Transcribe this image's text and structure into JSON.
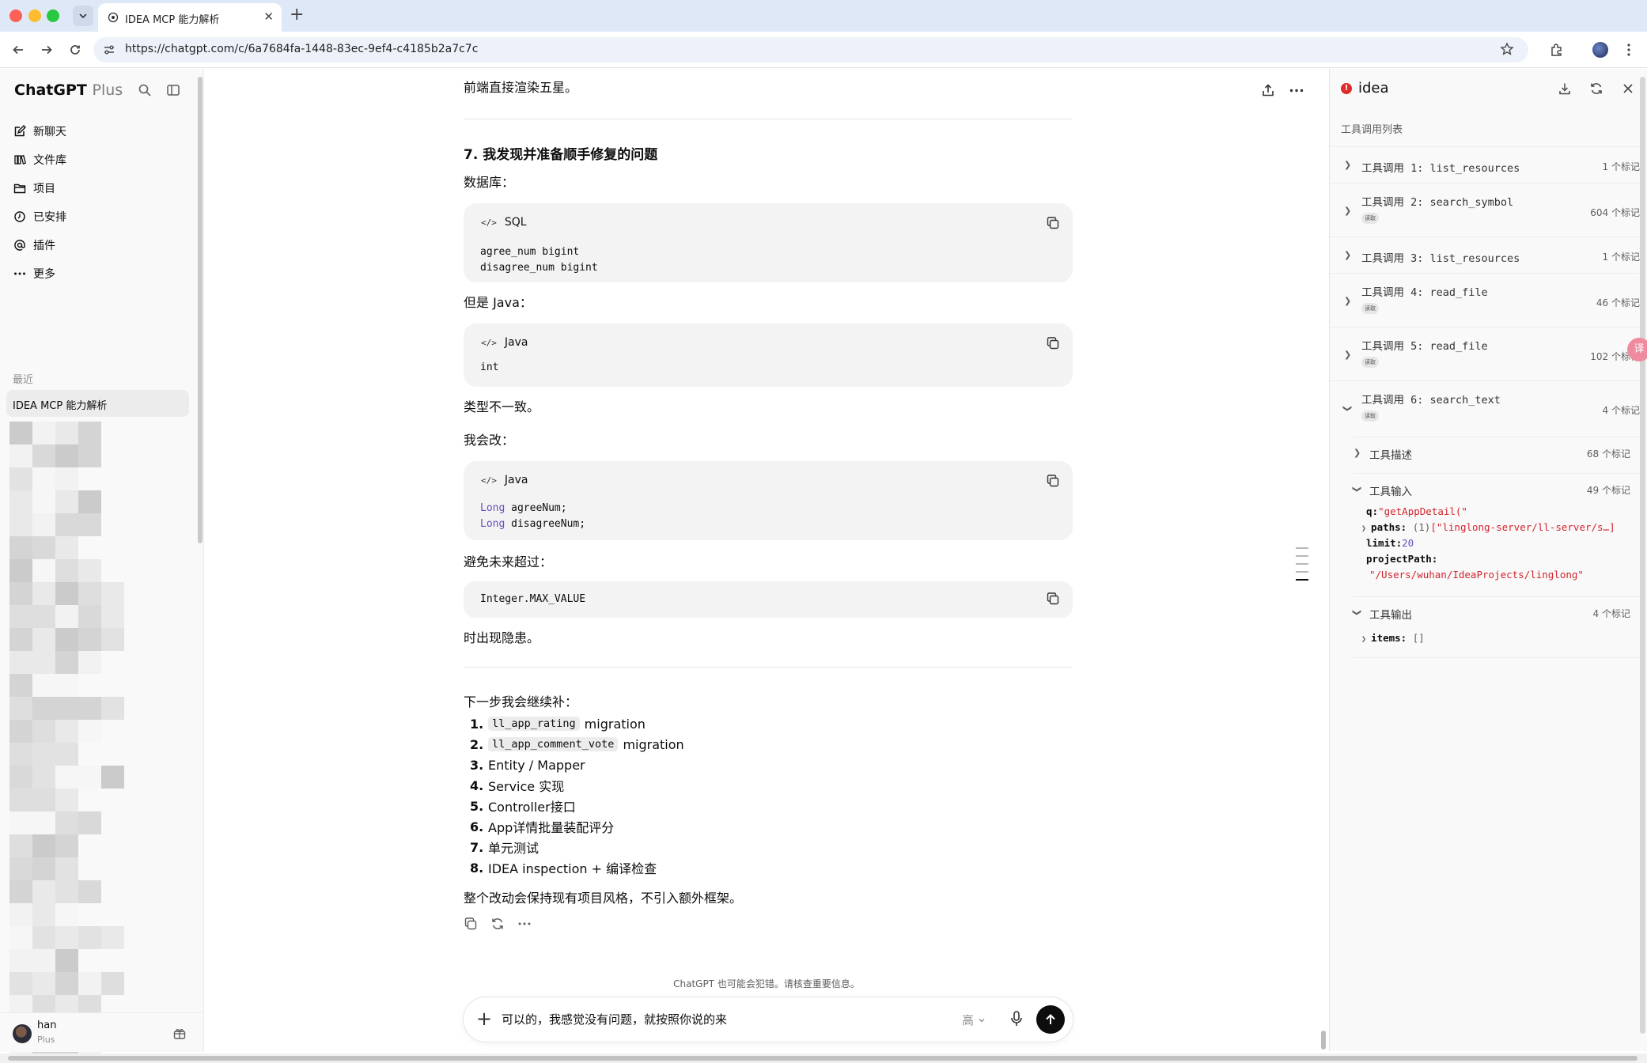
{
  "browser": {
    "tab_title": "IDEA MCP 能力解析",
    "url": "https://chatgpt.com/c/6a7684fa-1448-83ec-9ef4-c4185b2a7c7c"
  },
  "sidebar": {
    "brand": "ChatGPT",
    "brand_plan": "Plus",
    "nav": [
      {
        "label": "新聊天",
        "icon": "edit-icon"
      },
      {
        "label": "文件库",
        "icon": "library-icon"
      },
      {
        "label": "项目",
        "icon": "folder-icon"
      },
      {
        "label": "已安排",
        "icon": "clock-icon"
      },
      {
        "label": "插件",
        "icon": "at-icon"
      },
      {
        "label": "更多",
        "icon": "more-icon"
      }
    ],
    "recent_label": "最近",
    "active_chat": "IDEA MCP 能力解析",
    "user": {
      "name": "han",
      "plan": "Plus"
    }
  },
  "chat": {
    "intro_line": "前端直接渲染五星。",
    "section_title": "7. 我发现并准备顺手修复的问题",
    "db_label": "数据库：",
    "sql_block": {
      "lang": "SQL",
      "lines": [
        "agree_num bigint",
        "disagree_num bigint"
      ]
    },
    "java_label": "但是 Java：",
    "java_block": {
      "lang": "Java",
      "lines": [
        "int"
      ]
    },
    "type_mismatch": "类型不一致。",
    "will_change": "我会改：",
    "java_block2": {
      "lang": "Java",
      "line1_type": "Long",
      "line1_rest": " agreeNum;",
      "line2_type": "Long",
      "line2_rest": " disagreeNum;"
    },
    "avoid_label": "避免未来超过：",
    "const_block": {
      "line": "Integer.MAX_VALUE"
    },
    "risk_line": "时出现隐患。",
    "next_steps_label": "下一步我会继续补：",
    "steps": [
      {
        "num": "1.",
        "code": "ll_app_rating",
        "text": "migration"
      },
      {
        "num": "2.",
        "code": "ll_app_comment_vote",
        "text": "migration"
      },
      {
        "num": "3.",
        "code": "",
        "text": "Entity / Mapper"
      },
      {
        "num": "4.",
        "code": "",
        "text": "Service 实现"
      },
      {
        "num": "5.",
        "code": "",
        "text": "Controller接口"
      },
      {
        "num": "6.",
        "code": "",
        "text": "App详情批量装配评分"
      },
      {
        "num": "7.",
        "code": "",
        "text": "单元测试"
      },
      {
        "num": "8.",
        "code": "",
        "text": "IDEA inspection + 编译检查"
      }
    ],
    "closing": "整个改动会保持现有项目风格，不引入额外框架。",
    "disclaimer": "ChatGPT 也可能会犯错。请核查重要信息。",
    "composer": {
      "value": "可以的，我感觉没有问题，就按照你说的来",
      "effort": "高"
    }
  },
  "panel": {
    "title": "idea",
    "subtitle": "工具调用列表",
    "badge_text": "读取",
    "calls": [
      {
        "label": "工具调用 1: list_resources",
        "count": "1 个标记",
        "badge": false
      },
      {
        "label": "工具调用 2: search_symbol",
        "count": "604 个标记",
        "badge": true
      },
      {
        "label": "工具调用 3: list_resources",
        "count": "1 个标记",
        "badge": false
      },
      {
        "label": "工具调用 4: read_file",
        "count": "46 个标记",
        "badge": true
      },
      {
        "label": "工具调用 5: read_file",
        "count": "102 个标记",
        "badge": true
      },
      {
        "label": "工具调用 6: search_text",
        "count": "4 个标记",
        "badge": true
      }
    ],
    "details": {
      "desc_label": "工具描述",
      "desc_count": "68 个标记",
      "input_label": "工具输入",
      "input_count": "49 个标记",
      "q_key": "q:",
      "q_val": "\"getAppDetail(\"",
      "paths_key": "paths:",
      "paths_len": "(1)",
      "paths_val": "[\"linglong-server/ll-server/s…]",
      "limit_key": "limit:",
      "limit_val": "20",
      "project_key": "projectPath:",
      "project_val": "\"/Users/wuhan/IdeaProjects/linglong\"",
      "output_label": "工具输出",
      "output_count": "4 个标记",
      "items_key": "items:",
      "items_val": "[]"
    },
    "bubble_text": "译"
  }
}
